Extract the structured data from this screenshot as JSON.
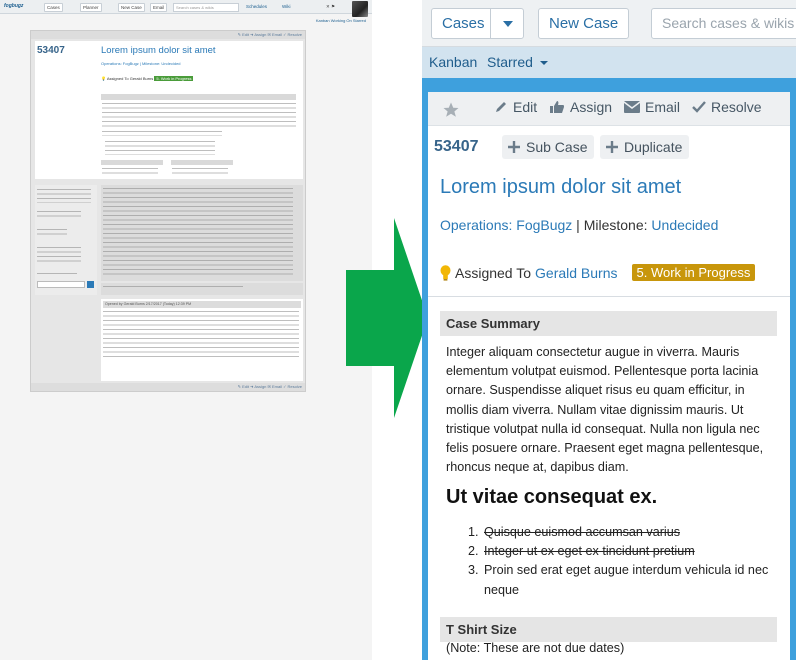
{
  "mini": {
    "logo": "fogbugz",
    "top_buttons": [
      "Cases",
      "Planner",
      "New Case",
      "Email"
    ],
    "search_placeholder": "Search cases & wikis",
    "right_links": [
      "Schedules",
      "Wiki"
    ],
    "subbar": "Kanban  Working On  Starred",
    "case_number": "53407",
    "case_title": "Lorem ipsum dolor sit amet",
    "opened_label": "Opened by Gerald Burns 2/17/2017 (Today) 12:39 PM"
  },
  "toolbar": {
    "cases_label": "Cases",
    "new_case_label": "New Case",
    "search_placeholder": "Search cases & wikis"
  },
  "nav": {
    "kanban_label": "Kanban",
    "starred_label": "Starred"
  },
  "actions": {
    "edit_label": "Edit",
    "assign_label": "Assign",
    "email_label": "Email",
    "resolve_label": "Resolve"
  },
  "case": {
    "number": "53407",
    "sub_case_label": "Sub Case",
    "duplicate_label": "Duplicate",
    "title": "Lorem ipsum dolor sit amet",
    "project_link": "Operations: FogBugz",
    "milestone_label": " | Milestone: ",
    "milestone_link": "Undecided",
    "assigned_prefix": "Assigned To ",
    "assignee": "Gerald Burns",
    "status": "5. Work in Progress"
  },
  "summary": {
    "heading": "Case Summary",
    "paragraph": "Integer aliquam consectetur augue in viverra. Mauris elementum volutpat euismod. Pellentesque porta lacinia ornare. Suspendisse aliquet risus eu quam efficitur, in mollis diam viverra. Nullam vitae dignissim mauris. Ut tristique volutpat nulla id consequat. Nulla non ligula nec felis posuere ornare. Praesent eget magna pellentesque, rhoncus neque at, dapibus diam.",
    "subheading": "Ut vitae consequat ex.",
    "list": [
      {
        "n": "1.",
        "text": "Quisque euismod accumsan varius",
        "done": true
      },
      {
        "n": "2.",
        "text": "Integer ut ex eget ex tincidunt pretium",
        "done": true
      },
      {
        "n": "3.",
        "text": "Proin sed erat eget augue interdum vehicula id nec neque",
        "done": false
      }
    ]
  },
  "tshirt": {
    "heading": "T Shirt Size",
    "note": "(Note: These are not due dates)"
  },
  "colors": {
    "accent_blue": "#3ea0dd",
    "link": "#2b7ab7",
    "status_badge": "#c8960b",
    "arrow": "#0aa64b"
  }
}
